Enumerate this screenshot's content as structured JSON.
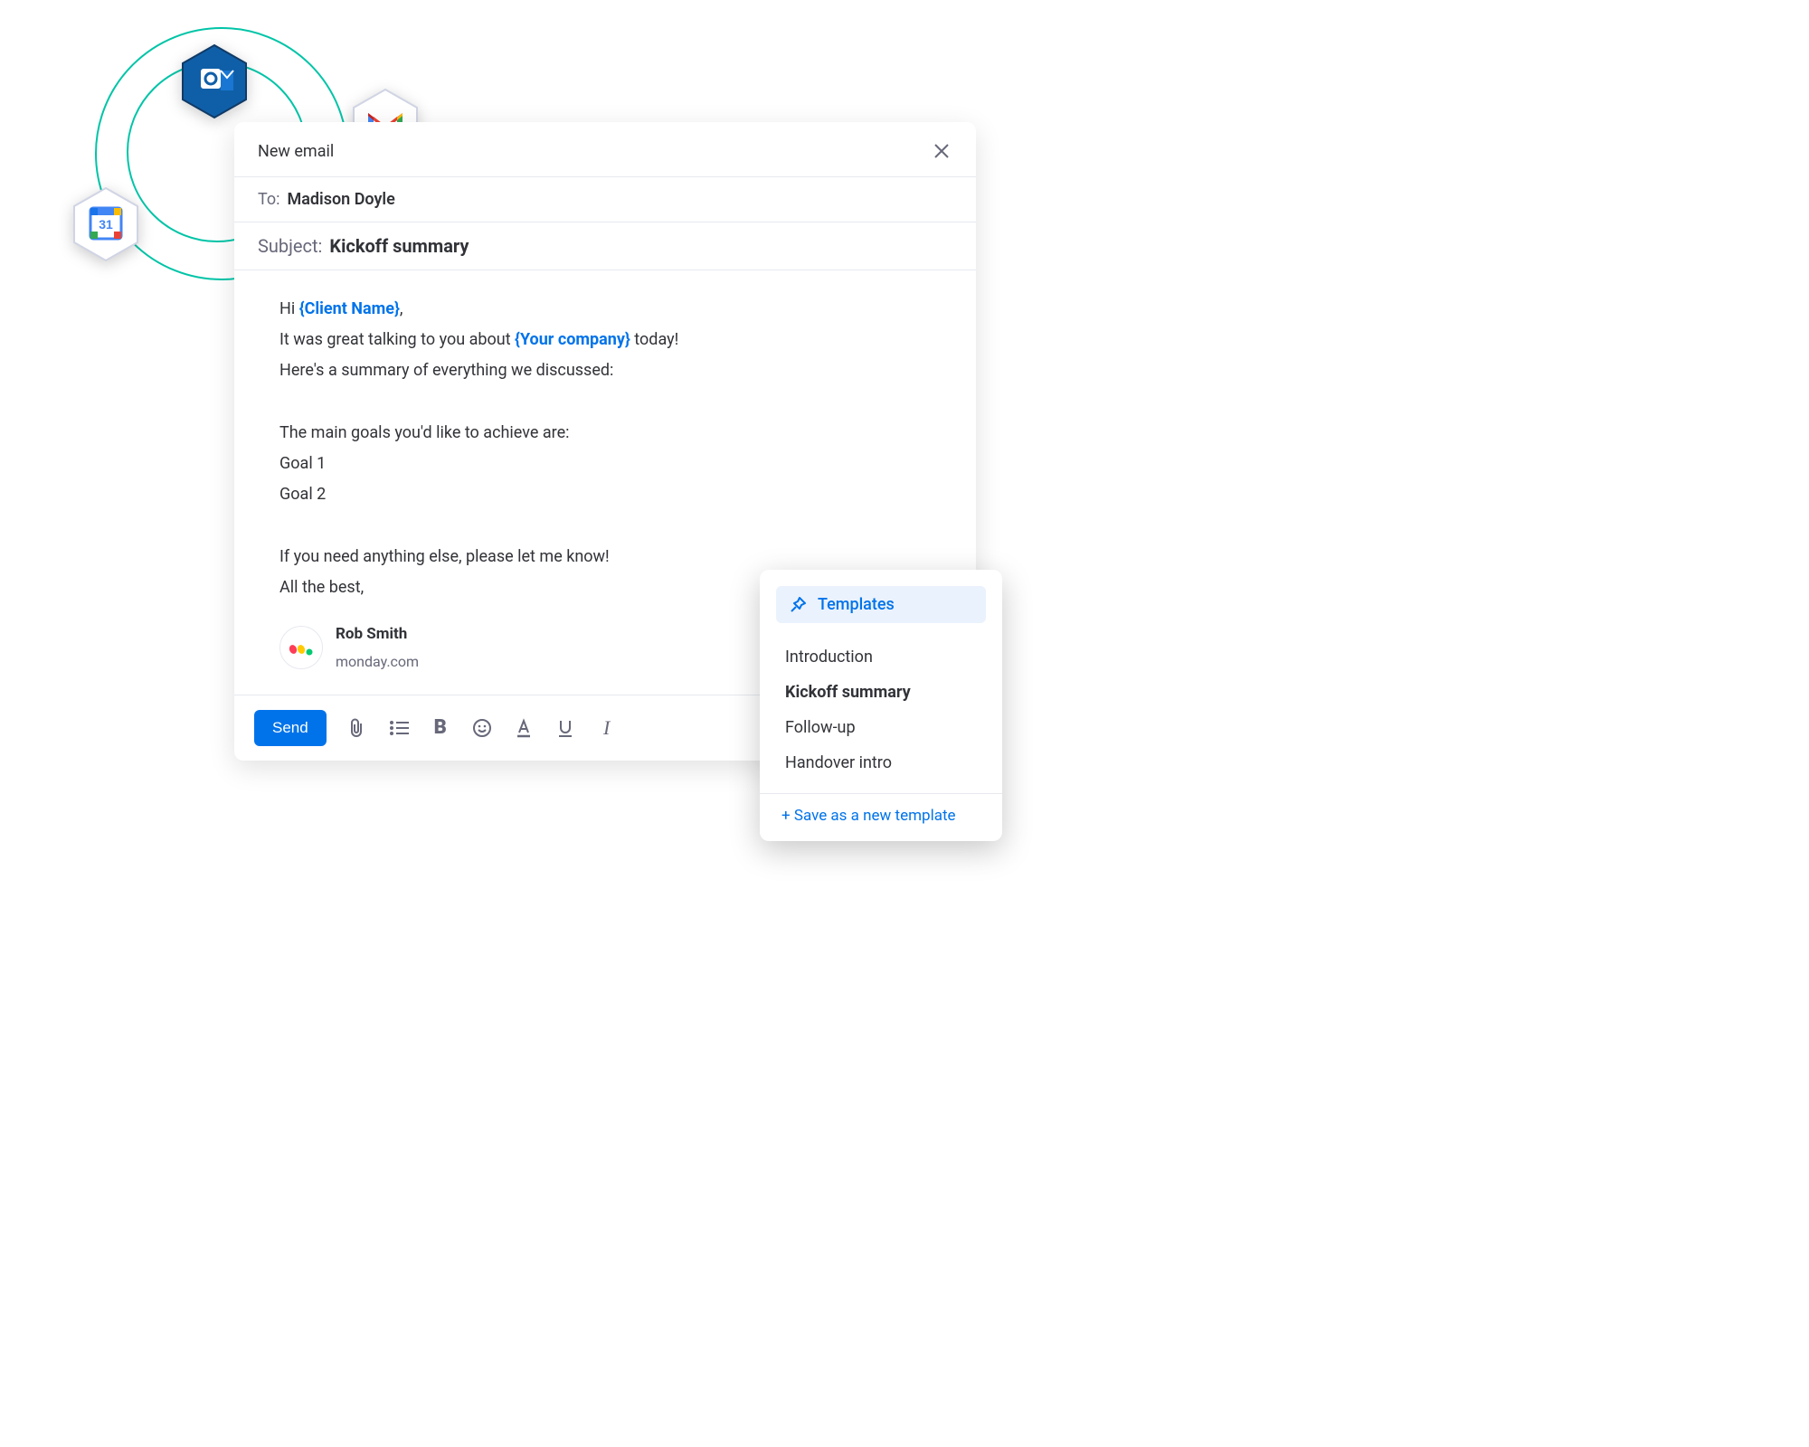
{
  "compose": {
    "title": "New email",
    "to_label": "To:",
    "to_value": "Madison Doyle",
    "subject_label": "Subject:",
    "subject_value": "Kickoff summary",
    "body": {
      "greeting_prefix": "Hi ",
      "token1": "{Client Name}",
      "greeting_suffix": ",",
      "line2_a": "It was great talking to you about ",
      "token2": "{Your company}",
      "line2_b": " today!",
      "line3": "Here's a summary of everything we discussed:",
      "line4": "The main goals you'd like to achieve are:",
      "goal1": "Goal 1",
      "goal2": "Goal 2",
      "line5": "If you need anything else, please let me know!",
      "line6": "All the best,"
    },
    "signature": {
      "name": "Rob Smith",
      "company": "monday.com"
    },
    "send_label": "Send"
  },
  "templates": {
    "header": "Templates",
    "items": [
      "Introduction",
      "Kickoff summary",
      "Follow-up",
      "Handover intro"
    ],
    "active_index": 1,
    "save_label": "+ Save as a new template"
  },
  "icons": {
    "outlook": "outlook",
    "gmail": "gmail",
    "calendar": "google-calendar"
  }
}
